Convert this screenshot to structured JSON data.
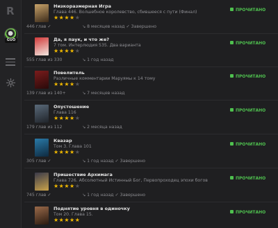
{
  "sidebar": {
    "logo": "R",
    "avatar_badge": "GUO"
  },
  "rows": [
    {
      "title": "Низкоразмерная Игра",
      "chapter": "Глава 446. Волшебное королевство, сбившееся с пути (Финал)",
      "rating": 4,
      "count": "446 глав ✓",
      "time": "↘ 8 месяцев назад  ✓ Завершено",
      "status": "ПРОЧИТАНО",
      "cover_colors": [
        "#c8a36a",
        "#3a2a1a"
      ]
    },
    {
      "title": "Да, я паук, и что же?",
      "chapter": "7 том. Интерлюдия 535. Два варианта",
      "rating": 4,
      "count": "555 глав из 330",
      "time": "↘ 1 год назад",
      "status": "ПРОЧИТАНО",
      "cover_colors": [
        "#d23a3a",
        "#f1e7e0"
      ]
    },
    {
      "title": "Повелитель",
      "chapter": "Различные комментарии Маруямы к 14 тому",
      "rating": 4,
      "count": "139 глав из 140+",
      "time": "↘ 7 месяцев назад",
      "status": "ПРОЧИТАНО",
      "cover_colors": [
        "#7a1c1c",
        "#2a0a0a"
      ]
    },
    {
      "title": "Опустошение",
      "chapter": "Глава 116",
      "rating": 4,
      "count": "179 глав из 112",
      "time": "↘ 2 месяца назад",
      "status": "ПРОЧИТАНО",
      "cover_colors": [
        "#5a6a7a",
        "#20242a"
      ]
    },
    {
      "title": "Квазар",
      "chapter": "Том 3. Глава 101",
      "rating": 4,
      "count": "305 глав ✓",
      "time": "↘ 1 год назад  ✓ Завершено",
      "status": "ПРОЧИТАНО",
      "cover_colors": [
        "#2a7aa8",
        "#0e2a40"
      ]
    },
    {
      "title": "Пришествие Архимага",
      "chapter": "Глава 726. Абсолютный Истинный Бог, Первопроходец эпохи богов",
      "rating": 4,
      "count": "745 глав ✓",
      "time": "↘ 1 год назад  ✓ Завершено",
      "status": "ПРОЧИТАНО",
      "cover_colors": [
        "#3a3a4a",
        "#c9a24a"
      ]
    },
    {
      "title": "Поднятие уровня в одиночку",
      "chapter": "Том 20. Глава 15.",
      "rating": 5,
      "count": "",
      "time": "",
      "status": "ПРОЧИТАНО",
      "cover_colors": [
        "#9a6a4a",
        "#2a1a10"
      ]
    }
  ],
  "colors": {
    "accent_green": "#4fc04f",
    "star": "#f0b800",
    "background": "#1f1f21"
  }
}
